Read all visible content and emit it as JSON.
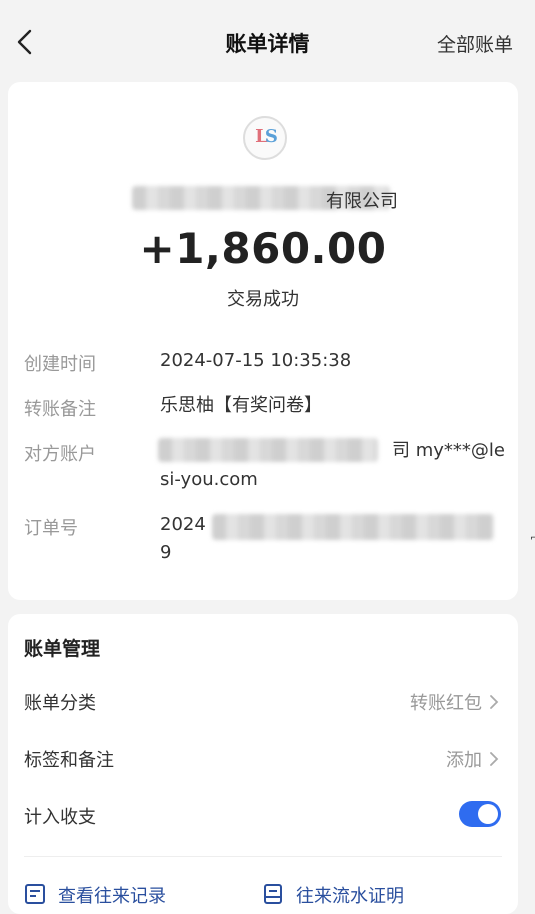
{
  "header": {
    "title": "账单详情",
    "all_bills": "全部账单"
  },
  "transaction": {
    "logo_text_a": "L",
    "logo_text_b": "S",
    "payee_suffix": "有限公司",
    "amount": "+1,860.00",
    "status": "交易成功"
  },
  "details": [
    {
      "label": "创建时间",
      "value": "2024-07-15 10:35:38"
    },
    {
      "label": "转账备注",
      "value": "乐思柚【有奖问卷】"
    },
    {
      "label": "对方账户",
      "value_tail": "司 my***@le",
      "value_line2": "si-you.com"
    },
    {
      "label": "订单号",
      "value_head": "2024",
      "value_line2": "9"
    }
  ],
  "management": {
    "title": "账单管理",
    "category_label": "账单分类",
    "category_value": "转账红包",
    "tags_label": "标签和备注",
    "tags_value": "添加",
    "count_label": "计入收支",
    "count_enabled": true
  },
  "links": {
    "records": "查看往来记录",
    "proof": "往来流水证明"
  },
  "colors": {
    "accent": "#2f6cf0",
    "link": "#2a4f9e",
    "muted": "#999999"
  }
}
